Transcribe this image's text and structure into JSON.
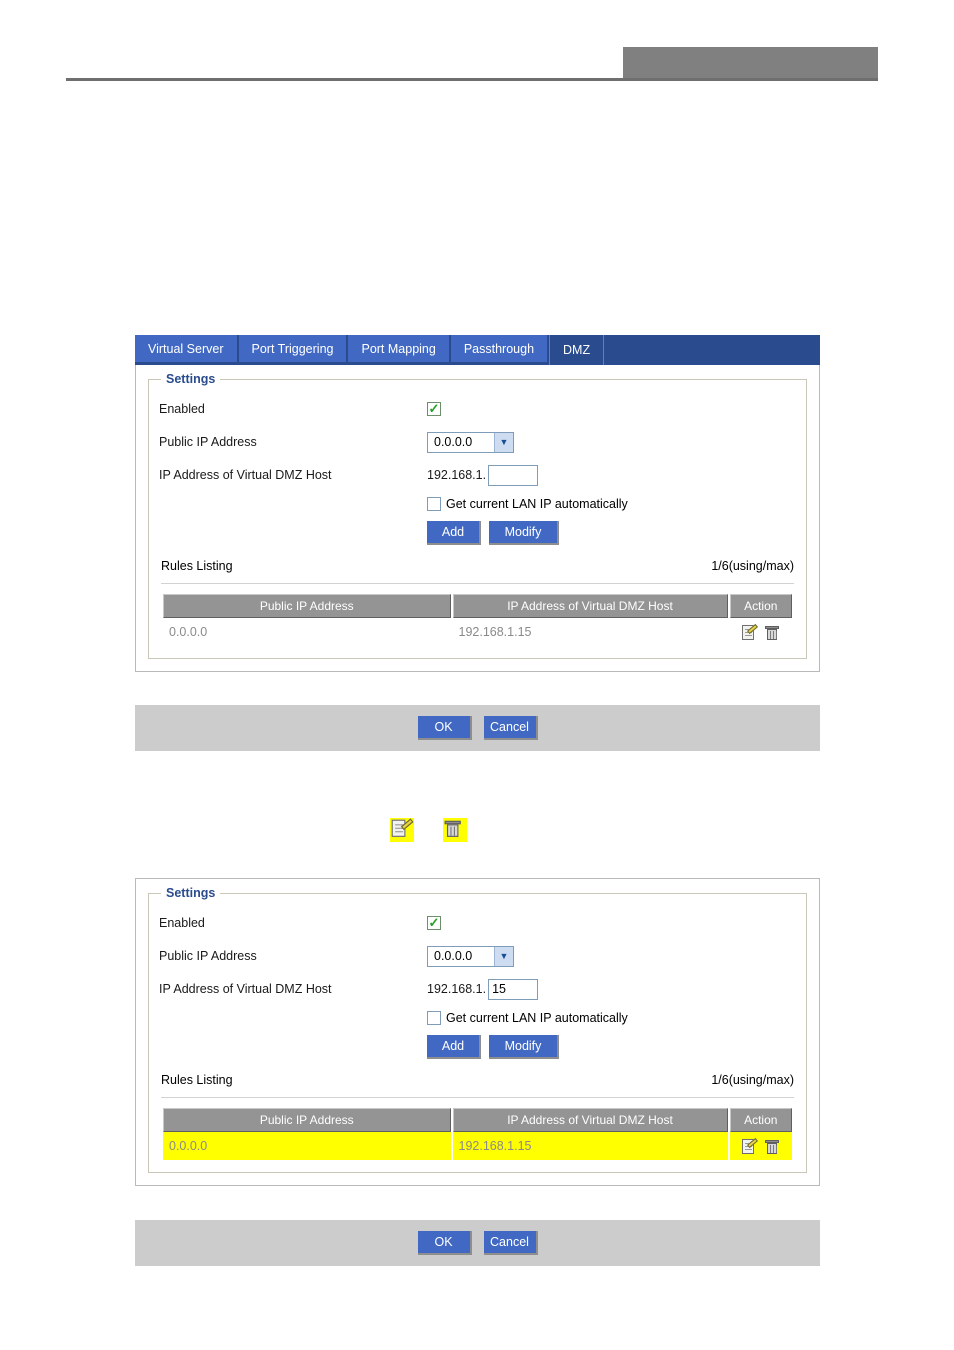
{
  "header": {
    "gray_block": "",
    "rule": ""
  },
  "tabs": [
    {
      "label": "Virtual Server",
      "active": false
    },
    {
      "label": "Port Triggering",
      "active": false
    },
    {
      "label": "Port Mapping",
      "active": false
    },
    {
      "label": "Passthrough",
      "active": false
    },
    {
      "label": "DMZ",
      "active": true
    }
  ],
  "panel_top": {
    "legend": "Settings",
    "enabled": {
      "label": "Enabled",
      "checked": true
    },
    "public_ip": {
      "label": "Public IP Address",
      "value": "0.0.0.0"
    },
    "dmz_host": {
      "label": "IP Address of Virtual DMZ Host",
      "prefix": "192.168.1.",
      "value": "",
      "placeholder": ""
    },
    "auto_lan": {
      "label": "Get current LAN IP automatically",
      "checked": false
    },
    "buttons": {
      "add": "Add",
      "modify": "Modify"
    },
    "rules_listing": {
      "label": "Rules Listing",
      "count": "1/6(using/max)"
    },
    "table": {
      "columns": [
        "Public IP Address",
        "IP Address of Virtual DMZ Host",
        "Action"
      ],
      "rows": [
        {
          "public_ip": "0.0.0.0",
          "dmz_host": "192.168.1.15",
          "highlight": false
        }
      ]
    }
  },
  "actionbar_top": {
    "ok": "OK",
    "cancel": "Cancel"
  },
  "icon_legend": {
    "edit": "edit-icon",
    "trash": "delete-icon"
  },
  "panel_bottom": {
    "legend": "Settings",
    "enabled": {
      "label": "Enabled",
      "checked": true
    },
    "public_ip": {
      "label": "Public IP Address",
      "value": "0.0.0.0"
    },
    "dmz_host": {
      "label": "IP Address of Virtual DMZ Host",
      "prefix": "192.168.1.",
      "value": "15",
      "placeholder": ""
    },
    "auto_lan": {
      "label": "Get current LAN IP automatically",
      "checked": false
    },
    "buttons": {
      "add": "Add",
      "modify": "Modify"
    },
    "rules_listing": {
      "label": "Rules Listing",
      "count": "1/6(using/max)"
    },
    "table": {
      "columns": [
        "Public IP Address",
        "IP Address of Virtual DMZ Host",
        "Action"
      ],
      "rows": [
        {
          "public_ip": "0.0.0.0",
          "dmz_host": "192.168.1.15",
          "highlight": true
        }
      ]
    }
  },
  "actionbar_bottom": {
    "ok": "OK",
    "cancel": "Cancel"
  },
  "colors": {
    "tab_bar": "#2a4c8f",
    "tab": "#4169c4",
    "button": "#4169c4",
    "legend_text": "#2a4c8f",
    "table_header": "#949494",
    "highlight": "#ffff00",
    "action_bar": "#cccccc",
    "header_block": "#808080"
  }
}
